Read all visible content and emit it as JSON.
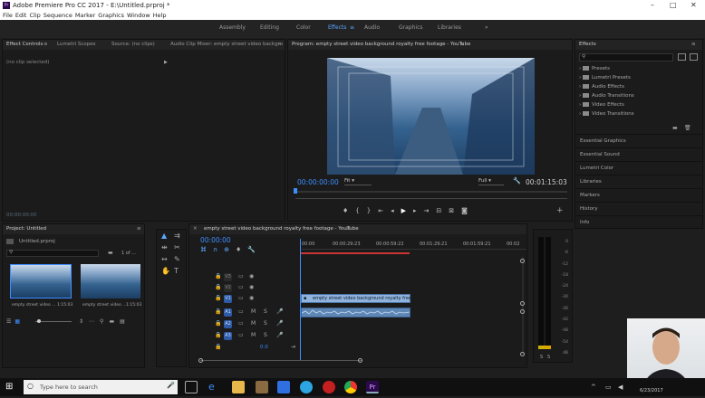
{
  "titlebar": {
    "title": "Adobe Premiere Pro CC 2017 - E:\\Untitled.prproj *",
    "minimize": "–",
    "maximize": "□",
    "close": "✕"
  },
  "menu": [
    "File",
    "Edit",
    "Clip",
    "Sequence",
    "Marker",
    "Graphics",
    "Window",
    "Help"
  ],
  "workspaces": {
    "tabs": [
      "Assembly",
      "Editing",
      "Color",
      "Effects",
      "Audio",
      "Graphics",
      "Libraries"
    ],
    "active": "Effects",
    "more": "»"
  },
  "source_panel": {
    "tabs": [
      "Effect Controls",
      "Lumetri Scopes",
      "Source: (no clips)",
      "Audio Clip Mixer: empty street video backgro"
    ],
    "no_clip": "(no clip selected)",
    "timecode": "00:00:00:00"
  },
  "program_panel": {
    "title": "Program: empty street video background royalty free footage - YouTube",
    "timecode": "00:00:00:00",
    "fit": "Fit",
    "quality": "Full",
    "duration": "00:01:15:03"
  },
  "effects_panel": {
    "title": "Effects",
    "tree": [
      "Presets",
      "Lumetri Presets",
      "Audio Effects",
      "Audio Transitions",
      "Video Effects",
      "Video Transitions"
    ],
    "sections": [
      "Essential Graphics",
      "Essential Sound",
      "Lumetri Color",
      "Libraries",
      "Markers",
      "History",
      "Info"
    ]
  },
  "project_panel": {
    "title": "Project: Untitled",
    "file": "Untitled.prproj",
    "count": "1 of ...",
    "clips": [
      {
        "name": "empty street video ...",
        "duration": "1:15:03"
      },
      {
        "name": "empty street video ...",
        "duration": "1:15:03"
      }
    ]
  },
  "timeline": {
    "title": "empty street video background royalty free footage - YouTube",
    "timecode": "00:00:00",
    "ruler": [
      "00:00",
      "00:00:29:23",
      "00:00:59:22",
      "00:01:29:21",
      "00:01:59:21",
      "00:02"
    ],
    "video_tracks": [
      "V3",
      "V2",
      "V1"
    ],
    "audio_tracks": [
      "A1",
      "A2",
      "A3"
    ],
    "master_value": "0.0",
    "clip_label": "empty street video background royalty free"
  },
  "meter_scale": [
    "0",
    "-6",
    "-12",
    "-18",
    "-24",
    "-30",
    "-36",
    "-42",
    "-48",
    "-54",
    "dB"
  ],
  "meter_solo": [
    "S",
    "S"
  ],
  "taskbar": {
    "search_placeholder": "Type here to search",
    "time": "6/23/2017"
  }
}
